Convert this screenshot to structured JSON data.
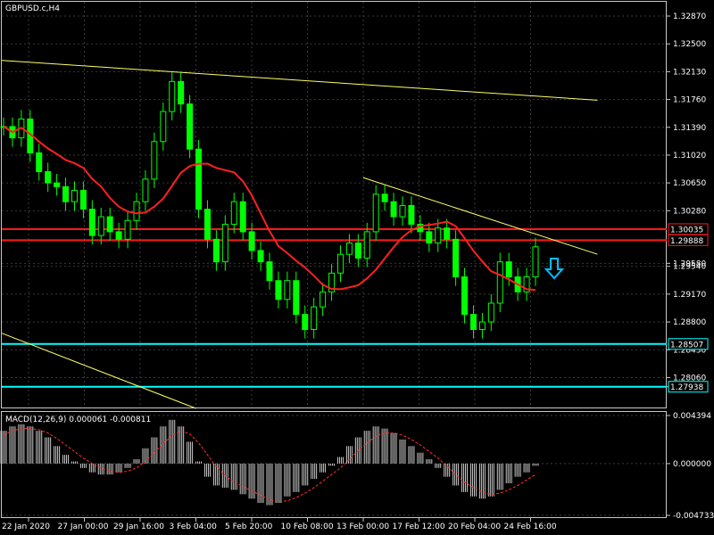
{
  "window": {
    "title": "GBPUSD.c,H4"
  },
  "colors": {
    "background": "#000000",
    "grid": "#3a3a3a",
    "frame": "#c8c8c8",
    "candle": "#00ff00",
    "moving_average": "#ff2020",
    "resistance": "#ff1a1a",
    "support": "#00ffff",
    "trendline": "#ffff66",
    "macd_hist": "#c8c8c8",
    "macd_signal": "#ff3030",
    "arrow": "#00bfff"
  },
  "icons": {
    "sell_arrow": "down-arrow-icon"
  },
  "chart_data": [
    {
      "type": "candlestick",
      "title": "GBPUSD.c,H4",
      "price_ticks": [
        "1.32870",
        "1.32500",
        "1.32130",
        "1.31760",
        "1.31390",
        "1.31020",
        "1.30650",
        "1.30280",
        "1.29580",
        "1.29540",
        "1.29170",
        "1.28800",
        "1.28430",
        "1.28060",
        "1.27938"
      ],
      "ylim": [
        1.2765,
        1.3306
      ],
      "time_ticks": [
        "22 Jan 2020",
        "27 Jan 00:00",
        "29 Jan 16:00",
        "3 Feb 04:00",
        "5 Feb 20:00",
        "10 Feb 08:00",
        "13 Feb 00:00",
        "17 Feb 12:00",
        "20 Feb 04:00",
        "24 Feb 16:00"
      ],
      "close": [
        1.314,
        1.3125,
        1.315,
        1.3105,
        1.308,
        1.3065,
        1.306,
        1.304,
        1.3055,
        1.303,
        1.2995,
        1.302,
        1.3,
        1.299,
        1.3015,
        1.304,
        1.307,
        1.312,
        1.316,
        1.32,
        1.317,
        1.311,
        1.303,
        1.299,
        1.296,
        1.301,
        1.304,
        1.3,
        1.2975,
        1.296,
        1.2935,
        1.291,
        1.2935,
        1.289,
        1.287,
        1.29,
        1.292,
        1.2945,
        1.297,
        1.2985,
        1.2965,
        1.3,
        1.305,
        1.304,
        1.302,
        1.3035,
        1.301,
        1.3,
        1.2985,
        1.3005,
        1.299,
        1.294,
        1.289,
        1.287,
        1.288,
        1.2905,
        1.296,
        1.294,
        1.292,
        1.294,
        1.298
      ],
      "horizontal_levels": [
        {
          "label": "1.30035",
          "value": 1.30035,
          "kind": "resistance"
        },
        {
          "label": "1.29888",
          "value": 1.29888,
          "kind": "resistance"
        },
        {
          "label": "1.28507",
          "value": 1.28507,
          "kind": "support"
        },
        {
          "label": "1.27938",
          "value": 1.27938,
          "kind": "support"
        }
      ],
      "trendlines": [
        {
          "name": "upper-downtrend",
          "from": [
            "22 Jan 2020",
            1.3228
          ],
          "to": [
            "24 Feb 16:00+",
            1.3175
          ]
        },
        {
          "name": "short-downtrend",
          "from": [
            "13 Feb 00:00",
            1.3072
          ],
          "to": [
            "24 Feb 16:00+",
            1.297
          ]
        },
        {
          "name": "lower-downtrend",
          "from": [
            "22 Jan 2020",
            1.2865
          ],
          "to": [
            "3 Feb 04:00",
            1.2765
          ]
        }
      ],
      "grid": true
    },
    {
      "type": "macd",
      "label": "MACD(12,26,9) 0.000061 -0.000811",
      "ticks": [
        "0.004394",
        "0.000000",
        "-0.004733"
      ],
      "ylim": [
        -0.004733,
        0.004394
      ],
      "histogram": [
        0.003,
        0.0034,
        0.0036,
        0.0034,
        0.003,
        0.0024,
        0.0016,
        0.0008,
        0.0002,
        -0.0004,
        -0.0008,
        -0.001,
        -0.001,
        -0.0008,
        -0.0004,
        0.0004,
        0.0014,
        0.0024,
        0.0034,
        0.004,
        0.0034,
        0.002,
        0.0002,
        -0.0012,
        -0.002,
        -0.0022,
        -0.0024,
        -0.0028,
        -0.0032,
        -0.0036,
        -0.0038,
        -0.0036,
        -0.003,
        -0.0026,
        -0.002,
        -0.0014,
        -0.0008,
        -0.0002,
        0.0006,
        0.0016,
        0.0024,
        0.003,
        0.0034,
        0.0032,
        0.0028,
        0.0022,
        0.0016,
        0.001,
        0.0004,
        -0.0004,
        -0.0012,
        -0.002,
        -0.0026,
        -0.003,
        -0.0032,
        -0.003,
        -0.0024,
        -0.0018,
        -0.0012,
        -0.0008,
        -0.0002
      ],
      "signal": [
        0.0026,
        0.003,
        0.0032,
        0.0032,
        0.0031,
        0.0028,
        0.0023,
        0.0017,
        0.0011,
        0.0005,
        0.0,
        -0.0004,
        -0.0007,
        -0.0008,
        -0.0007,
        -0.0004,
        0.0002,
        0.001,
        0.0018,
        0.0026,
        0.003,
        0.0027,
        0.0019,
        0.0008,
        -0.0003,
        -0.0011,
        -0.0017,
        -0.0021,
        -0.0025,
        -0.0029,
        -0.0033,
        -0.0035,
        -0.0034,
        -0.0031,
        -0.0027,
        -0.0022,
        -0.0016,
        -0.001,
        -0.0004,
        0.0004,
        0.0012,
        0.0019,
        0.0025,
        0.0028,
        0.0028,
        0.0026,
        0.0022,
        0.0017,
        0.0011,
        0.0005,
        -0.0002,
        -0.001,
        -0.0017,
        -0.0022,
        -0.0026,
        -0.0028,
        -0.0027,
        -0.0024,
        -0.002,
        -0.0015,
        -0.001
      ]
    }
  ]
}
